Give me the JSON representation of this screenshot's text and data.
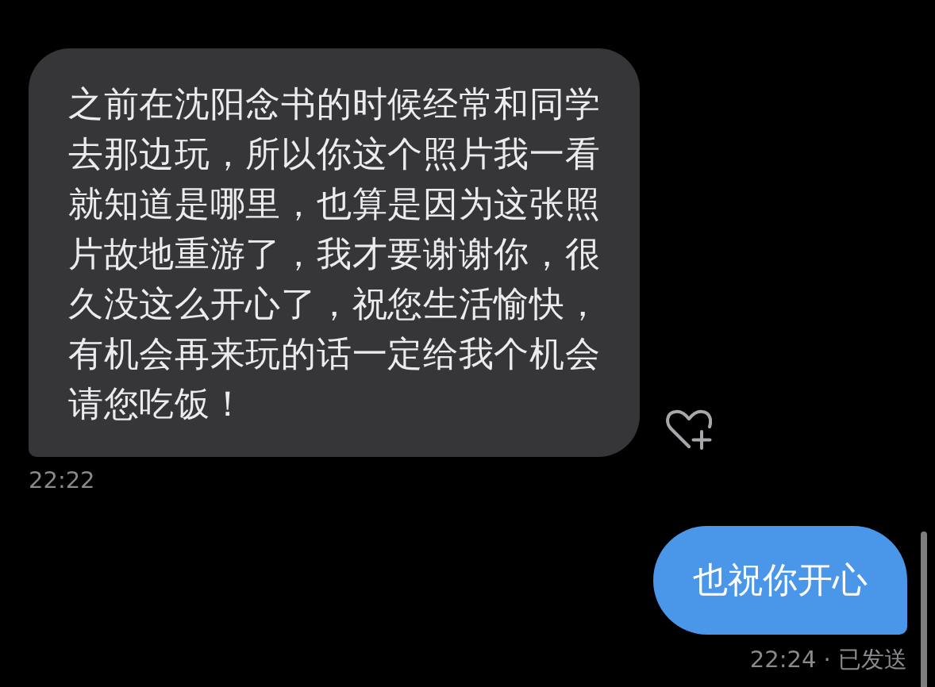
{
  "messages": [
    {
      "kind": "received",
      "text": "之前在沈阳念书的时候经常和同学去那边玩，所以你这个照片我一看就知道是哪里，也算是因为这张照片故地重游了，我才要谢谢你，很久没这么开心了，祝您生活愉快，有机会再来玩的话一定给我个机会请您吃饭！",
      "meta": "22:22"
    },
    {
      "kind": "sent",
      "text": "也祝你开心",
      "meta": "22:24 · 已发送"
    }
  ]
}
